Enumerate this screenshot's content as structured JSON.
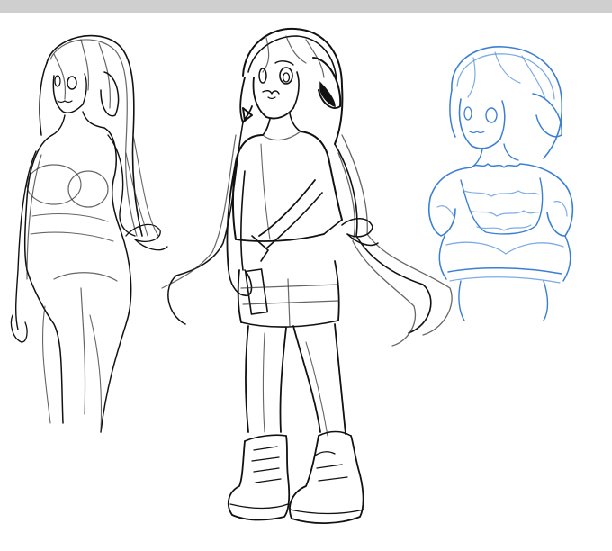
{
  "canvas": {
    "background": "#ffffff",
    "top_bar_color": "#cfcfcf"
  },
  "sketch": {
    "ink_color": "#111111",
    "blue_color": "#3a7fd5",
    "figures": [
      {
        "name": "left-figure",
        "style": "rough black sketch, long hair, three-quarter view"
      },
      {
        "name": "center-figure",
        "style": "black sketch, full body, t-shirt, shorts, boots"
      },
      {
        "name": "right-figure",
        "style": "blue sketch, bust, short hair, frilled top"
      }
    ]
  }
}
